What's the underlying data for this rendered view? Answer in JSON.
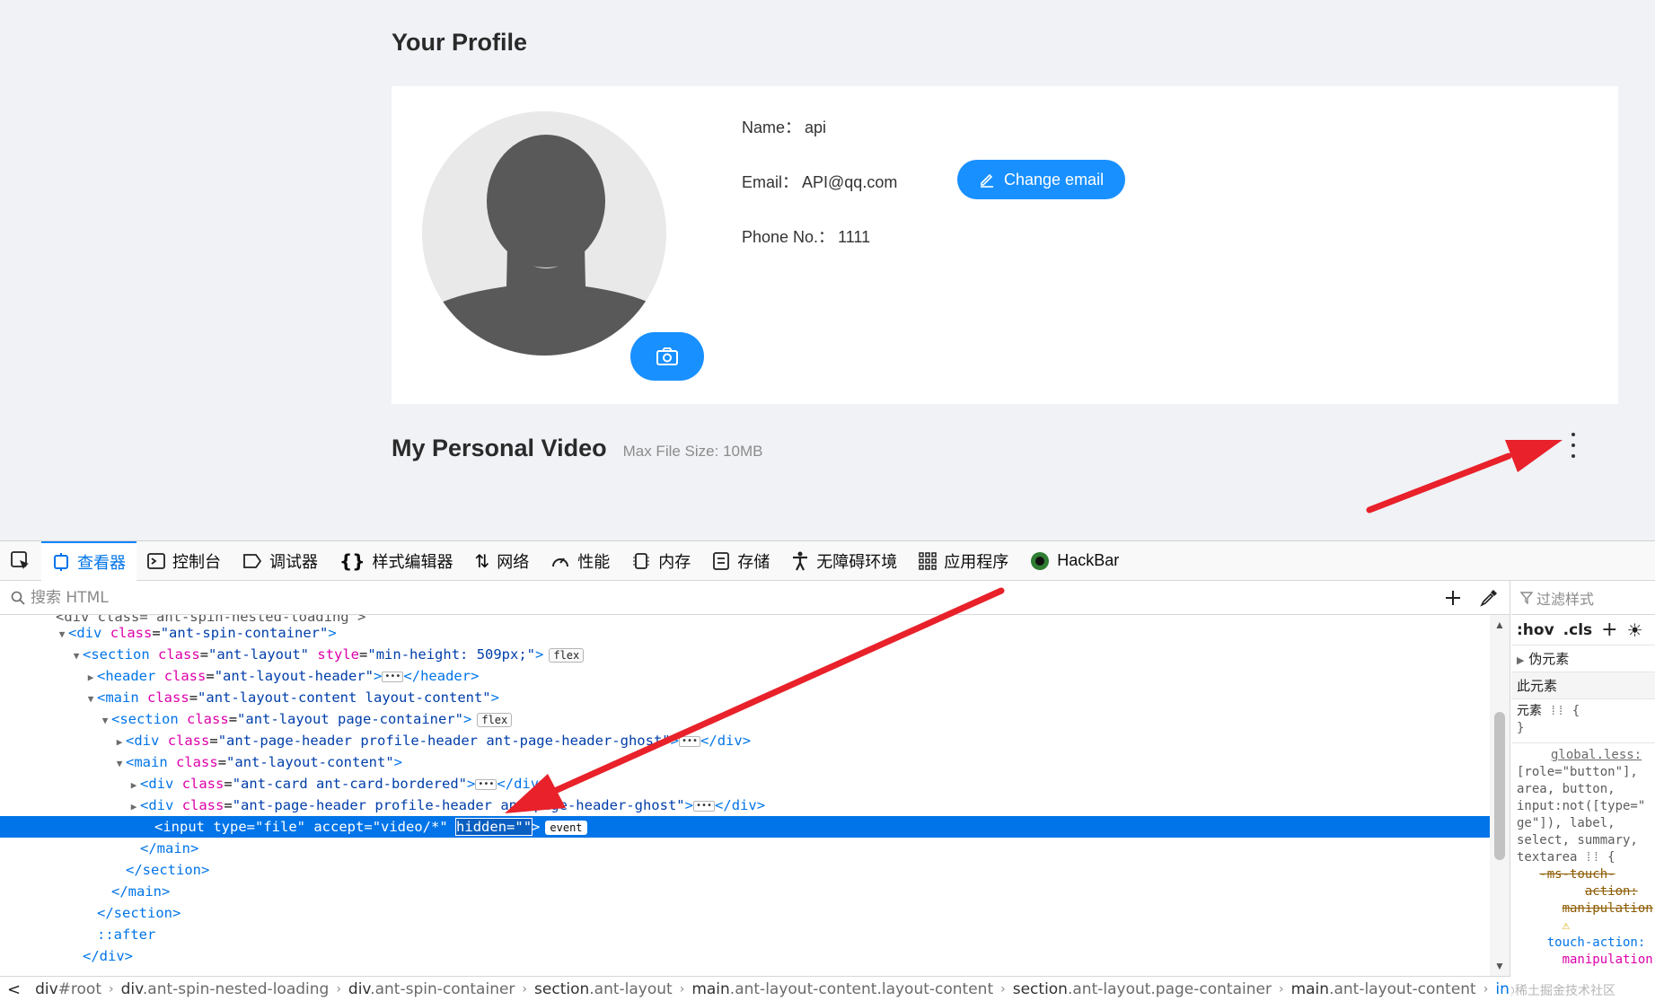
{
  "page": {
    "title": "Your Profile",
    "profile": {
      "name_label": "Name：",
      "name_value": "api",
      "email_label": "Email：",
      "email_value": "API@qq.com",
      "phone_label": "Phone No.：",
      "phone_value": "1111",
      "change_email_label": "Change email"
    },
    "video_section": {
      "title": "My Personal Video",
      "subtitle": "Max File Size: 10MB"
    }
  },
  "devtools": {
    "tabs": [
      {
        "label": "查看器",
        "icon": "inspector-icon",
        "active": true
      },
      {
        "label": "控制台",
        "icon": "console-icon"
      },
      {
        "label": "调试器",
        "icon": "debugger-icon"
      },
      {
        "label": "样式编辑器",
        "icon": "braces-icon"
      },
      {
        "label": "网络",
        "icon": "network-arrows-icon"
      },
      {
        "label": "性能",
        "icon": "performance-gauge-icon"
      },
      {
        "label": "内存",
        "icon": "memory-chip-icon"
      },
      {
        "label": "存储",
        "icon": "storage-icon"
      },
      {
        "label": "无障碍环境",
        "icon": "accessibility-icon"
      },
      {
        "label": "应用程序",
        "icon": "application-grid-icon"
      },
      {
        "label": "HackBar",
        "icon": "hackbar-icon"
      }
    ],
    "search_placeholder": "搜索 HTML",
    "tree": {
      "l0": "<div class=\"ant-spin-nested-loading\">",
      "l1_tag": "div",
      "l1_attr": "class",
      "l1_val": "\"ant-spin-container\"",
      "l2_tag": "section",
      "l2_attr1": "class",
      "l2_val1": "\"ant-layout\"",
      "l2_attr2": "style",
      "l2_val2": "\"min-height: 509px;\"",
      "l2_badge": "flex",
      "l3_tag": "header",
      "l3_attr": "class",
      "l3_val": "\"ant-layout-header\"",
      "l3_close": "</header>",
      "l4_tag": "main",
      "l4_attr": "class",
      "l4_val": "\"ant-layout-content layout-content\"",
      "l5_tag": "section",
      "l5_attr": "class",
      "l5_val": "\"ant-layout page-container\"",
      "l5_badge": "flex",
      "l6_tag": "div",
      "l6_attr": "class",
      "l6_val": "\"ant-page-header profile-header ant-page-header-ghost\"",
      "l6_close": "</div>",
      "l7_tag": "main",
      "l7_attr": "class",
      "l7_val": "\"ant-layout-content\"",
      "l8_tag": "div",
      "l8_attr": "class",
      "l8_val": "\"ant-card ant-card-bordered\"",
      "l8_close": "</div>",
      "l9_tag": "div",
      "l9_attr": "class",
      "l9_val": "\"ant-page-header profile-header ant-page-header-ghost\"",
      "l9_close": "</div>",
      "sel_open": "<input ",
      "sel_a1": "type",
      "sel_v1": "\"file\"",
      "sel_a2": "accept",
      "sel_v2": "\"video/*\"",
      "sel_a3": "hidden",
      "sel_v3": "\"\"",
      "sel_close": ">",
      "sel_badge": "event",
      "c1": "</main>",
      "c2": "</section>",
      "c3": "</main>",
      "c4": "</section>",
      "after": "::after",
      "c5": "</div>"
    },
    "breadcrumbs": [
      {
        "tag": "div",
        "cls": "#root"
      },
      {
        "tag": "div",
        "cls": ".ant-spin-nested-loading"
      },
      {
        "tag": "div",
        "cls": ".ant-spin-container"
      },
      {
        "tag": "section",
        "cls": ".ant-layout"
      },
      {
        "tag": "main",
        "cls": ".ant-layout-content.layout-content"
      },
      {
        "tag": "section",
        "cls": ".ant-layout.page-container"
      },
      {
        "tag": "main",
        "cls": ".ant-layout-content"
      },
      {
        "tag": "input",
        "cls": ""
      }
    ],
    "rules": {
      "filter_placeholder": "过滤样式",
      "hov": ":hov",
      "cls": ".cls",
      "pseudo_elements": "伪元素",
      "this_element": "此元素",
      "element_rule": "元素",
      "element_brace_open": "{",
      "element_brace_close": "}",
      "source_link": "global.less:",
      "selector_lines": [
        "[role=\"button\"],",
        "area, button,",
        "input:not([type=\"",
        "ge\"]), label,",
        "select, summary,",
        "textarea"
      ],
      "struck_prop": "-ms-touch-",
      "struck_prop2": "action:",
      "struck_val": "manipulation",
      "prop": "touch-action:",
      "prop_val": "manipulation"
    },
    "watermark": "@稀土掘金技术社区"
  },
  "colors": {
    "accent": "#1890ff",
    "selection": "#0074e8",
    "arrow": "#e8212a"
  }
}
